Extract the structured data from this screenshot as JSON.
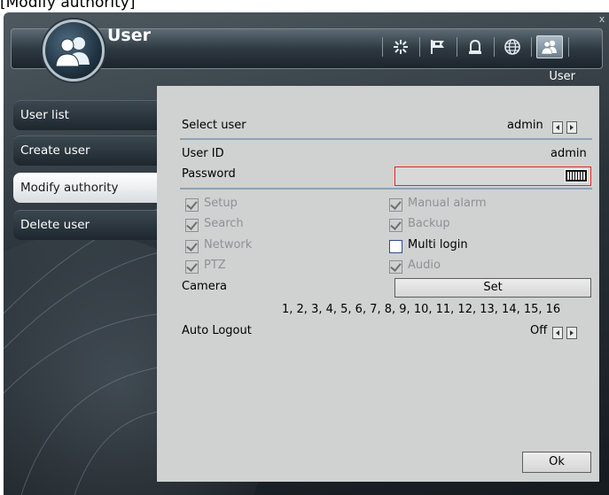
{
  "caption": "[Modify authority]",
  "window": {
    "title": "User",
    "subtitle": "User",
    "close_label": "x"
  },
  "toolbar": {
    "icons": [
      "settings-star-icon",
      "flag-icon",
      "alarm-bell-icon",
      "globe-icon",
      "user-icon"
    ],
    "active": "user-icon"
  },
  "sidebar": {
    "items": [
      {
        "label": "User list"
      },
      {
        "label": "Create user"
      },
      {
        "label": "Modify authority"
      },
      {
        "label": "Delete user"
      }
    ],
    "active_index": 2
  },
  "form": {
    "select_user_label": "Select user",
    "select_user_value": "admin",
    "user_id_label": "User ID",
    "user_id_value": "admin",
    "password_label": "Password",
    "password_value": "",
    "permissions": [
      {
        "label": "Setup",
        "checked": true,
        "enabled": false
      },
      {
        "label": "Manual alarm",
        "checked": true,
        "enabled": false
      },
      {
        "label": "Search",
        "checked": true,
        "enabled": false
      },
      {
        "label": "Backup",
        "checked": true,
        "enabled": false
      },
      {
        "label": "Network",
        "checked": true,
        "enabled": false
      },
      {
        "label": "Multi login",
        "checked": false,
        "enabled": true
      },
      {
        "label": "PTZ",
        "checked": true,
        "enabled": false
      },
      {
        "label": "Audio",
        "checked": true,
        "enabled": false
      }
    ],
    "camera_label": "Camera",
    "camera_set_button": "Set",
    "camera_list": "1, 2, 3, 4, 5, 6, 7, 8, 9, 10, 11, 12, 13, 14, 15, 16",
    "auto_logout_label": "Auto Logout",
    "auto_logout_value": "Off",
    "ok_button": "Ok"
  },
  "colors": {
    "panel_bg": "#cfd2d1",
    "focus_border": "#e1262b",
    "divider": "#8ea3b4",
    "disabled_text": "#8e9194"
  }
}
